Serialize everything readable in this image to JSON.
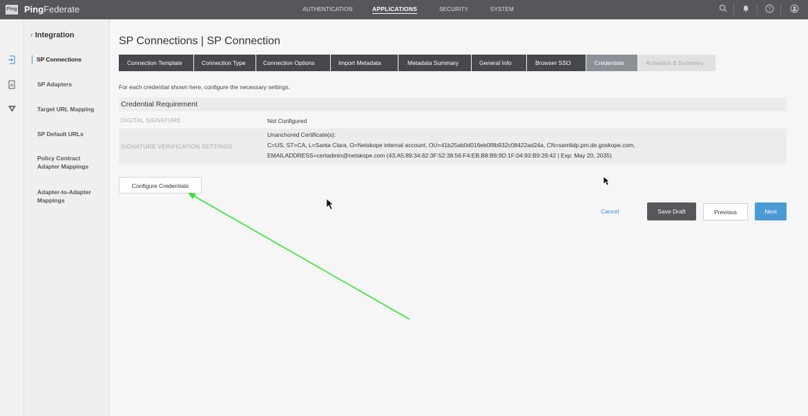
{
  "app": {
    "logo_text": "Ping",
    "brand_bold": "Ping",
    "brand_rest": "Federate"
  },
  "topnav": {
    "items": [
      {
        "label": "AUTHENTICATION",
        "active": false
      },
      {
        "label": "APPLICATIONS",
        "active": true
      },
      {
        "label": "SECURITY",
        "active": false
      },
      {
        "label": "SYSTEM",
        "active": false
      }
    ],
    "icons": [
      "search-icon",
      "bell-icon",
      "help-icon",
      "user-icon"
    ]
  },
  "sidebar": {
    "back_label": "Integration",
    "items": [
      {
        "label": "SP Connections",
        "active": true
      },
      {
        "label": "SP Adapters",
        "active": false
      },
      {
        "label": "Target URL Mapping",
        "active": false
      },
      {
        "label": "SP Default URLs",
        "active": false
      },
      {
        "label": "Policy Contract Adapter Mappings",
        "active": false
      },
      {
        "label": "Adapter-to-Adapter Mappings",
        "active": false
      }
    ]
  },
  "page": {
    "title": "SP Connections | SP Connection",
    "tabs": [
      {
        "label": "Connection Template",
        "state": "done"
      },
      {
        "label": "Connection Type",
        "state": "done"
      },
      {
        "label": "Connection Options",
        "state": "done"
      },
      {
        "label": "Import Metadata",
        "state": "done"
      },
      {
        "label": "Metadata Summary",
        "state": "done"
      },
      {
        "label": "General Info",
        "state": "done"
      },
      {
        "label": "Browser SSO",
        "state": "done"
      },
      {
        "label": "Credentials",
        "state": "current"
      },
      {
        "label": "Activation & Summary",
        "state": "disabled"
      }
    ],
    "intro": "For each credential shown here, configure the necessary settings.",
    "section_title": "Credential Requirement",
    "rows": {
      "digital_signature_label": "DIGITAL SIGNATURE",
      "digital_signature_value": "Not Configured",
      "sig_verification_label": "SIGNATURE VERIFICATION SETTINGS",
      "sig_verification_line1": "Unanchored Certificate(s):",
      "sig_verification_line2": "C=US, ST=CA, L=Santa Clara, O=Netskope internal account, OU=41b25ab0d016eb0f8b932c08422ad24a, CN=samlidp.pm.de.goskope.com,",
      "sig_verification_line3": "EMAILADDRESS=certadmin@netskope.com (43:A5:89:34:62:3F:52:38:56:F4:EB:B8:B8:9D:1F:04:93:B9:29:42 | Exp: May 20, 2035)"
    },
    "configure_button": "Configure Credentials",
    "actions": {
      "cancel": "Cancel",
      "save_draft": "Save Draft",
      "previous": "Previous",
      "next": "Next"
    }
  },
  "colors": {
    "topbar": "#55575b",
    "tab_active": "#46484d",
    "tab_current": "#8c9097",
    "accent": "#4a9ad6",
    "annotation_arrow": "#2ee62e"
  }
}
